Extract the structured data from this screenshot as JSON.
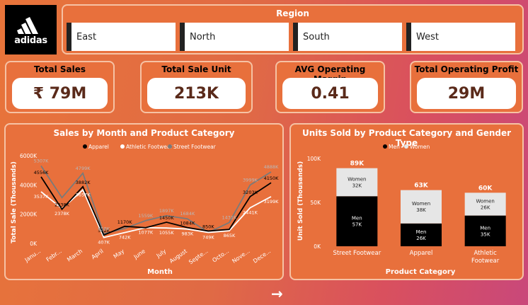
{
  "brand": {
    "logo_text": "adidas"
  },
  "region": {
    "title": "Region",
    "options": [
      "East",
      "North",
      "South",
      "West"
    ]
  },
  "kpis": [
    {
      "title": "Total Sales",
      "value": "₹ 79M"
    },
    {
      "title": "Total Sale Unit",
      "value": "213K"
    },
    {
      "title": "AVG Operating Margin",
      "value": "0.41"
    },
    {
      "title": "Total Operating Profit",
      "value": "29M"
    }
  ],
  "colors": {
    "apparel": "#000000",
    "athletic_footwear": "#ffffff",
    "street_footwear": "#7a7a7a",
    "men": "#000000",
    "women": "#e6e6e6",
    "panel": "#e8703c"
  },
  "nav": {
    "next_icon": "arrow-right-icon",
    "next_label": "→"
  },
  "chart_data": [
    {
      "type": "line",
      "title": "Sales by Month and Product Category",
      "xlabel": "Month",
      "ylabel": "Total Sale (Thousands)",
      "ylim": [
        0,
        6000
      ],
      "y_ticks": [
        "0K",
        "2000K",
        "4000K",
        "6000K"
      ],
      "legend_position": "top",
      "categories": [
        "Janu...",
        "Febr...",
        "March",
        "April",
        "May",
        "June",
        "July",
        "August",
        "Septe...",
        "Octo...",
        "Nove...",
        "Dece..."
      ],
      "series": [
        {
          "name": "Apparel",
          "values": [
            4556,
            2338,
            3882,
            572,
            1170,
            1077,
            1450,
            1084,
            850,
            963,
            3203,
            4150
          ],
          "labels": [
            "4556K",
            "2338K",
            "3882K",
            "572K",
            "1170K",
            "",
            "1450K",
            "1084K",
            "850K",
            "",
            "3203K",
            "4150K"
          ]
        },
        {
          "name": "Athletic Footwear",
          "values": [
            3537,
            2378,
            3657,
            407,
            742,
            1077,
            1055,
            983,
            749,
            865,
            2441,
            3199
          ],
          "labels": [
            "3537K",
            "2378K",
            "3657K",
            "407K",
            "742K",
            "1077K",
            "1055K",
            "983K",
            "749K",
            "865K",
            "2441K",
            "3199K"
          ]
        },
        {
          "name": "Street Footwear",
          "values": [
            5307,
            3130,
            4799,
            658,
            1025,
            1559,
            1897,
            1684,
            749,
            1431,
            3999,
            4888
          ],
          "labels": [
            "5307K",
            "",
            "4799K",
            "658K",
            "",
            "1559K",
            "1897K",
            "1684K",
            "",
            "1431K",
            "3999K",
            "4888K"
          ]
        }
      ]
    },
    {
      "type": "bar",
      "stacked": true,
      "title": "Units Sold by Product Category and Gender Type",
      "xlabel": "Product Category",
      "ylabel": "Unit Sold (Thousands)",
      "ylim": [
        0,
        100
      ],
      "y_ticks": [
        "0K",
        "50K",
        "100K"
      ],
      "legend_position": "top",
      "categories": [
        "Street Footwear",
        "Apparel",
        "Athletic Footwear"
      ],
      "totals": [
        "89K",
        "63K",
        "60K"
      ],
      "series": [
        {
          "name": "Men",
          "values": [
            57,
            26,
            35
          ],
          "labels": [
            "57K",
            "26K",
            "35K"
          ]
        },
        {
          "name": "Women",
          "values": [
            32,
            38,
            26
          ],
          "labels": [
            "32K",
            "38K",
            "26K"
          ]
        }
      ]
    }
  ]
}
